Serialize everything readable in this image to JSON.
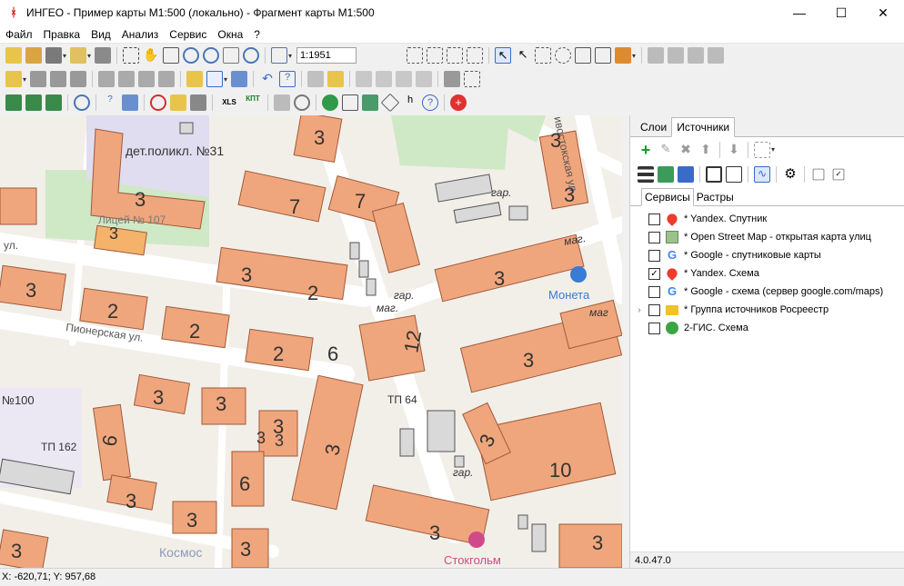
{
  "window": {
    "title": "ИНГЕО - Пример карты М1:500 (локально) - Фрагмент карты М1:500",
    "minimize": "—",
    "maximize": "☐",
    "close": "✕"
  },
  "menu": [
    "Файл",
    "Правка",
    "Вид",
    "Анализ",
    "Сервис",
    "Окна",
    "?"
  ],
  "toolbar": {
    "scale_value": "1:1951",
    "xls_label": "XLS",
    "kpt_label": "КПТ"
  },
  "right_panel": {
    "tabs": [
      "Слои",
      "Источники"
    ],
    "active_tab": "Источники",
    "subtabs": [
      "Сервисы",
      "Растры"
    ],
    "active_subtab": "Сервисы",
    "sources": [
      {
        "label": "* Yandex. Спутник",
        "checked": false,
        "icon": "yandex-pin-icon",
        "expandable": false
      },
      {
        "label": "* Open Street Map - открытая карта улиц",
        "checked": false,
        "icon": "osm-icon",
        "expandable": false
      },
      {
        "label": "* Google - спутниковые карты",
        "checked": false,
        "icon": "google-icon",
        "expandable": false
      },
      {
        "label": "* Yandex. Схема",
        "checked": true,
        "icon": "yandex-pin-icon",
        "expandable": false
      },
      {
        "label": "* Google - схема (сервер google.com/maps)",
        "checked": false,
        "icon": "google-icon",
        "expandable": false
      },
      {
        "label": "* Группа источников Росреестр",
        "checked": false,
        "icon": "folder-icon",
        "expandable": true
      },
      {
        "label": "2-ГИС. Схема",
        "checked": false,
        "icon": "2gis-icon",
        "expandable": false
      }
    ],
    "version": "4.0.47.0"
  },
  "statusbar": {
    "coords": "X: -620,71; Y: 957,68"
  },
  "map": {
    "labels": {
      "polyclinic": "дет.поликл. №31",
      "lyceum": "Лицей № 107",
      "pionerskaya": "Пионерская ул.",
      "ul": "ул.",
      "no100": "№100",
      "tp162": "ТП 162",
      "tp64": "ТП 64",
      "gar1": "гар.",
      "gar2": "гар.",
      "gar3": "гар.",
      "mag1": "маг.",
      "mag2": "маг.",
      "mag3": "маг",
      "vostochnaya": "ивостокская ул.",
      "moneta": "Монета",
      "kosmos": "Космос",
      "stockholm": "Стокгольм"
    },
    "building_numbers": [
      "3",
      "3",
      "3",
      "7",
      "7",
      "3",
      "3",
      "2",
      "2",
      "2",
      "2",
      "6",
      "12",
      "3",
      "3",
      "3",
      "3",
      "3",
      "3",
      "3",
      "6",
      "3",
      "3",
      "3",
      "6",
      "10",
      "3",
      "3",
      "3",
      "3",
      "3",
      "3",
      "3"
    ]
  }
}
